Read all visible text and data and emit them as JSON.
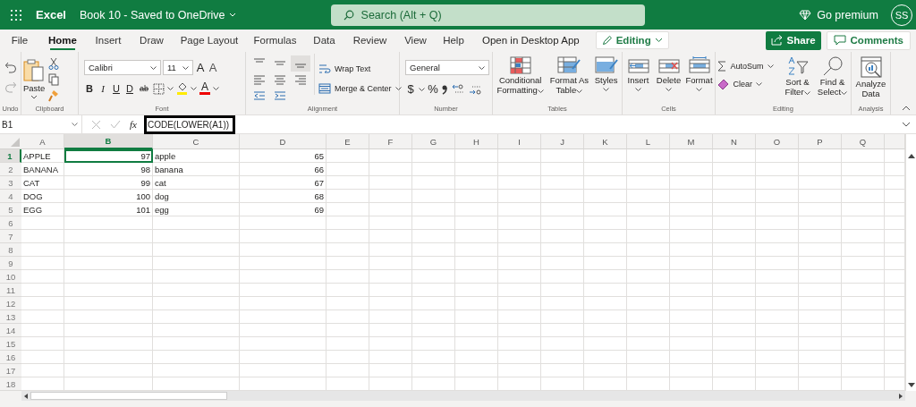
{
  "app_bar": {
    "app_name": "Excel",
    "document_title": "Book 10 - Saved to OneDrive",
    "search": {
      "placeholder": "Search (Alt + Q)"
    },
    "premium": "Go premium",
    "avatar": "SS"
  },
  "menu_tabs": [
    {
      "label": "File",
      "selected": false
    },
    {
      "label": "Home",
      "selected": true
    },
    {
      "label": "Insert",
      "selected": false
    },
    {
      "label": "Draw",
      "selected": false
    },
    {
      "label": "Page Layout",
      "selected": false
    },
    {
      "label": "Formulas",
      "selected": false
    },
    {
      "label": "Data",
      "selected": false
    },
    {
      "label": "Review",
      "selected": false
    },
    {
      "label": "View",
      "selected": false
    },
    {
      "label": "Help",
      "selected": false
    }
  ],
  "open_desktop": "Open in Desktop App",
  "mode": "Editing",
  "share": "Share",
  "comments": "Comments",
  "ribbon": {
    "undo": {
      "label": "Undo"
    },
    "clipboard": {
      "paste": "Paste",
      "label": "Clipboard"
    },
    "font": {
      "family": "Calibri",
      "size": "11",
      "grow": "A",
      "shrink": "A",
      "styles": [
        "B",
        "I",
        "U",
        "D",
        "ab"
      ],
      "color_button": "A",
      "label": "Font"
    },
    "alignment": {
      "vertical": [
        {
          "selected": false
        },
        {
          "selected": false
        },
        {
          "selected": true
        }
      ],
      "wrap": "Wrap Text",
      "merge": "Merge & Center",
      "label": "Alignment"
    },
    "number": {
      "format": "General",
      "currency": "$",
      "percent": "%",
      "label": "Number"
    },
    "tables": {
      "conditional": "Conditional Formatting",
      "format_table": "Format As Table",
      "styles": "Styles",
      "label": "Tables"
    },
    "cells": {
      "insert": "Insert",
      "delete": "Delete",
      "format": "Format",
      "label": "Cells"
    },
    "editing": {
      "autosum": "AutoSum",
      "clear": "Clear",
      "sort": "Sort & Filter",
      "find": "Find & Select",
      "label": "Editing"
    },
    "analysis": {
      "analyze": "Analyze Data",
      "label": "Analysis"
    }
  },
  "formula_bar": {
    "name_box": "B1",
    "function_label": "fx",
    "formula": "CODE(LOWER(A1))"
  },
  "grid": {
    "columns": [
      {
        "letter": "A",
        "selected": false
      },
      {
        "letter": "B",
        "selected": true
      },
      {
        "letter": "C",
        "selected": false
      },
      {
        "letter": "D",
        "selected": false
      },
      {
        "letter": "E",
        "selected": false
      },
      {
        "letter": "F",
        "selected": false
      },
      {
        "letter": "G",
        "selected": false
      },
      {
        "letter": "H",
        "selected": false
      },
      {
        "letter": "I",
        "selected": false
      },
      {
        "letter": "J",
        "selected": false
      },
      {
        "letter": "K",
        "selected": false
      },
      {
        "letter": "L",
        "selected": false
      },
      {
        "letter": "M",
        "selected": false
      },
      {
        "letter": "N",
        "selected": false
      },
      {
        "letter": "O",
        "selected": false
      },
      {
        "letter": "P",
        "selected": false
      },
      {
        "letter": "Q",
        "selected": false
      }
    ],
    "rows": [
      {
        "number": "1",
        "selected": true,
        "cells": [
          {
            "value": "APPLE",
            "kind": "text",
            "selected": false
          },
          {
            "value": "97",
            "kind": "number",
            "selected": true
          },
          {
            "value": "apple",
            "kind": "text",
            "selected": false
          },
          {
            "value": "65",
            "kind": "number",
            "selected": false
          }
        ]
      },
      {
        "number": "2",
        "selected": false,
        "cells": [
          {
            "value": "BANANA",
            "kind": "text",
            "selected": false
          },
          {
            "value": "98",
            "kind": "number",
            "selected": false
          },
          {
            "value": "banana",
            "kind": "text",
            "selected": false
          },
          {
            "value": "66",
            "kind": "number",
            "selected": false
          }
        ]
      },
      {
        "number": "3",
        "selected": false,
        "cells": [
          {
            "value": "CAT",
            "kind": "text",
            "selected": false
          },
          {
            "value": "99",
            "kind": "number",
            "selected": false
          },
          {
            "value": "cat",
            "kind": "text",
            "selected": false
          },
          {
            "value": "67",
            "kind": "number",
            "selected": false
          }
        ]
      },
      {
        "number": "4",
        "selected": false,
        "cells": [
          {
            "value": "DOG",
            "kind": "text",
            "selected": false
          },
          {
            "value": "100",
            "kind": "number",
            "selected": false
          },
          {
            "value": "dog",
            "kind": "text",
            "selected": false
          },
          {
            "value": "68",
            "kind": "number",
            "selected": false
          }
        ]
      },
      {
        "number": "5",
        "selected": false,
        "cells": [
          {
            "value": "EGG",
            "kind": "text",
            "selected": false
          },
          {
            "value": "101",
            "kind": "number",
            "selected": false
          },
          {
            "value": "egg",
            "kind": "text",
            "selected": false
          },
          {
            "value": "69",
            "kind": "number",
            "selected": false
          }
        ]
      },
      {
        "number": "6",
        "selected": false
      },
      {
        "number": "7",
        "selected": false
      },
      {
        "number": "8",
        "selected": false
      },
      {
        "number": "9",
        "selected": false
      },
      {
        "number": "10",
        "selected": false
      },
      {
        "number": "11",
        "selected": false
      },
      {
        "number": "12",
        "selected": false
      },
      {
        "number": "13",
        "selected": false
      },
      {
        "number": "14",
        "selected": false
      },
      {
        "number": "15",
        "selected": false
      },
      {
        "number": "16",
        "selected": false
      },
      {
        "number": "17",
        "selected": false
      },
      {
        "number": "18",
        "selected": false
      }
    ]
  }
}
